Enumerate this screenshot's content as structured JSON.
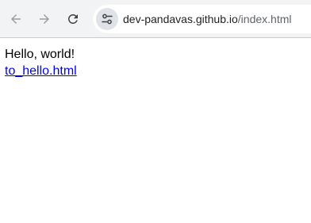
{
  "browser": {
    "url_host": "dev-pandavas.github.io",
    "url_path": "/index.html",
    "icons": {
      "back": "arrow-back-icon",
      "forward": "arrow-forward-icon",
      "reload": "reload-icon",
      "site_info": "tune-icon"
    }
  },
  "page": {
    "greeting": "Hello, world!",
    "link_text": "to_hello.html"
  },
  "colors": {
    "toolbar_bg": "#f1f3f4",
    "omnibox_bg": "#ffffff",
    "link": "#0000ee",
    "icon": "#5f6368"
  }
}
